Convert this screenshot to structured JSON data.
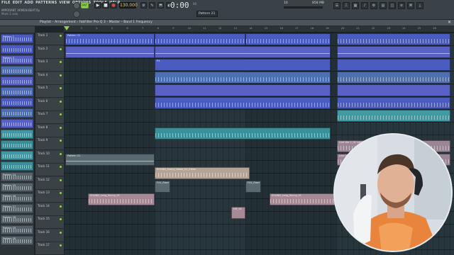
{
  "menu": [
    "FILE",
    "EDIT",
    "ADD",
    "PATTERNS",
    "VIEW",
    "OPTIONS",
    "TOOLS",
    "HELP"
  ],
  "project_name": "IMPORANT ARMEN BEAT.flp",
  "hint": "Mute 1 solo",
  "transport": {
    "pat_label": "PAT",
    "play_glyph": "▶",
    "stop_glyph": "■",
    "rec_glyph": "●",
    "tempo": "130.000"
  },
  "time": {
    "display": "0:00",
    "small": "00"
  },
  "tools": [
    "⚙",
    "✎",
    "⬒",
    "◐",
    "⤧",
    "✂",
    "▣"
  ],
  "pattern_selector": "Pattern 21",
  "cpu": "10",
  "memory": "858 MB",
  "right_tools": [
    "☰",
    "⎍",
    "▦",
    "♪",
    "⚙",
    "▤",
    "◫",
    "≡",
    "⌘",
    "⤓"
  ],
  "playlist_title": "Playlist – Arrangement › FabFilter Pro-Q 3 – Master – Band 1 Frequency",
  "close_glyph": "✕",
  "ruler": [
    "2",
    "3",
    "4",
    "5",
    "6",
    "7",
    "8",
    "9",
    "10",
    "11",
    "12",
    "13",
    "14",
    "15",
    "16",
    "17",
    "18",
    "19",
    "20",
    "21",
    "22",
    "23",
    "24",
    "25",
    "26"
  ],
  "picker_items": [
    {
      "label": "Pattern 1",
      "color": "#4b5bbf"
    },
    {
      "label": "",
      "color": "#4b5bbf"
    },
    {
      "label": "Pattern 3",
      "color": "#5560c2"
    },
    {
      "label": "",
      "color": "#4d6fb0"
    },
    {
      "label": "",
      "color": "#5560c2"
    },
    {
      "label": "",
      "color": "#4e6cb8"
    },
    {
      "label": "",
      "color": "#4b5bbf"
    },
    {
      "label": "",
      "color": "#4d6fb0"
    },
    {
      "label": "",
      "color": "#5660c6"
    },
    {
      "label": "",
      "color": "#3f98a2"
    },
    {
      "label": "",
      "color": "#3a8e98"
    },
    {
      "label": "",
      "color": "#3f98a2"
    },
    {
      "label": "",
      "color": "#3a8e98"
    },
    {
      "label": "Pattern 14",
      "color": "#56626a"
    },
    {
      "label": "Pattern 15",
      "color": "#56626a"
    },
    {
      "label": "Pattern 16",
      "color": "#56626a"
    },
    {
      "label": "Pattern 17",
      "color": "#56626a"
    },
    {
      "label": "Pattern 18",
      "color": "#56626a"
    },
    {
      "label": "Pattern 19",
      "color": "#56626a"
    },
    {
      "label": "Pattern 20",
      "color": "#56626a"
    }
  ],
  "tracks": [
    "Track 1",
    "Track 2",
    "Track 3",
    "Track 4",
    "Track 5",
    "Track 6",
    "Track 7",
    "Track 8",
    "Track 9",
    "Track 10",
    "Track 11",
    "Track 12",
    "Track 13",
    "Track 14",
    "Track 15",
    "Track 16",
    "Track 17"
  ],
  "clip_labels": {
    "pattern": "Pattern 21",
    "lead": "Live Vox 1_01 Lead",
    "drums": "Live Drums 2",
    "sound1": "SOUND_Sunny_Down_01_Clean",
    "sound2": "SOUND_Long_Sunny_01",
    "fx1": "FX1_Riser",
    "fx2": "FX2_Riser",
    "p4": "P4",
    "hit": "HIT_01"
  }
}
